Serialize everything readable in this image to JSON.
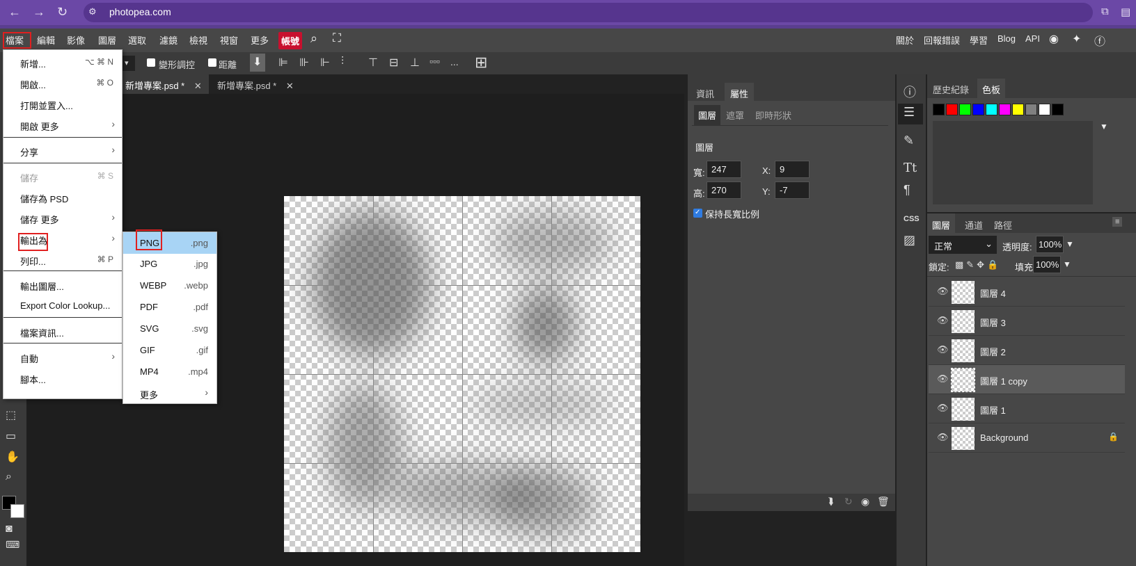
{
  "browser": {
    "url": "photopea.com"
  },
  "menubar": {
    "items": [
      "檔案",
      "編輯",
      "影像",
      "圖層",
      "選取",
      "濾鏡",
      "檢視",
      "視窗",
      "更多"
    ],
    "account": "帳號",
    "right": [
      "關於",
      "回報錯誤",
      "學習",
      "Blog",
      "API"
    ]
  },
  "options": {
    "transform": "變形調控",
    "distance": "距離"
  },
  "tabs": [
    "新增專案.psd *",
    "新增專案.psd *"
  ],
  "file_menu": [
    {
      "label": "新增...",
      "shortcut": "⌥ ⌘ N"
    },
    {
      "label": "開啟...",
      "shortcut": "⌘ O"
    },
    {
      "label": "打開並置入..."
    },
    {
      "label": "開啟 更多",
      "arrow": "›"
    },
    {
      "label": "分享",
      "arrow": "›"
    },
    {
      "label": "儲存",
      "shortcut": "⌘ S",
      "disabled": true
    },
    {
      "label": "儲存為 PSD"
    },
    {
      "label": "儲存 更多",
      "arrow": "›"
    },
    {
      "label": "輸出為",
      "arrow": "›"
    },
    {
      "label": "列印...",
      "shortcut": "⌘ P"
    },
    {
      "label": "輸出圖層..."
    },
    {
      "label": "Export Color Lookup..."
    },
    {
      "label": "檔案資訊..."
    },
    {
      "label": "自動",
      "arrow": "›"
    },
    {
      "label": "腳本..."
    }
  ],
  "export_submenu": [
    {
      "label": "PNG",
      "ext": ".png"
    },
    {
      "label": "JPG",
      "ext": ".jpg"
    },
    {
      "label": "WEBP",
      "ext": ".webp"
    },
    {
      "label": "PDF",
      "ext": ".pdf"
    },
    {
      "label": "SVG",
      "ext": ".svg"
    },
    {
      "label": "GIF",
      "ext": ".gif"
    },
    {
      "label": "MP4",
      "ext": ".mp4"
    },
    {
      "label": "更多",
      "arrow": "›"
    }
  ],
  "props": {
    "tabs": [
      "資訊",
      "屬性"
    ],
    "subtabs": [
      "圖層",
      "遮罩",
      "即時形狀"
    ],
    "section": "圖層",
    "w_label": "寬:",
    "w": "247",
    "h_label": "高:",
    "h": "270",
    "x_label": "X:",
    "x": "9",
    "y_label": "Y:",
    "y": "-7",
    "keep_ratio": "保持長寬比例"
  },
  "history": {
    "tabs": [
      "歷史紀錄",
      "色板"
    ],
    "swatches": [
      "#000000",
      "#ff0000",
      "#00ff00",
      "#0000ff",
      "#00ffff",
      "#ff00ff",
      "#ffff00",
      "#808080",
      "#ffffff",
      "#000000"
    ]
  },
  "layers": {
    "tabs": [
      "圖層",
      "通道",
      "路徑"
    ],
    "blend": "正常",
    "opacity_label": "透明度:",
    "opacity": "100%",
    "lock_label": "鎖定:",
    "fill_label": "填充:",
    "fill": "100%",
    "rows": [
      "圖層 4",
      "圖層 3",
      "圖層 2",
      "圖層 1 copy",
      "圖層 1",
      "Background"
    ]
  },
  "rightcol": {
    "css": "CSS"
  }
}
